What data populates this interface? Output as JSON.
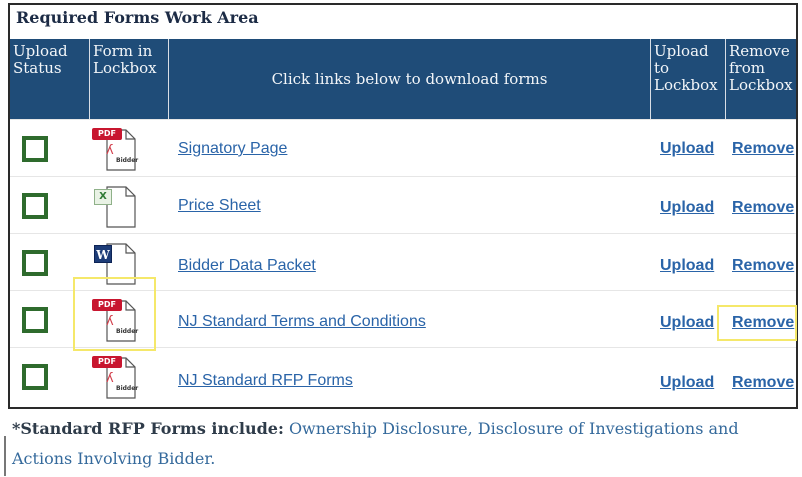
{
  "panel": {
    "title": "Required Forms Work Area"
  },
  "columns": {
    "upload_status": "Upload Status",
    "form_in_lockbox": "Form in Lockbox",
    "download_instruction": "Click links below to download forms",
    "upload_to_lockbox": "Upload to Lockbox",
    "remove_from_lockbox": "Remove from Lockbox"
  },
  "rows": [
    {
      "icon": "pdf-file-icon",
      "form": "Signatory Page",
      "upload": "Upload",
      "remove": "Remove"
    },
    {
      "icon": "excel-file-icon",
      "form": "Price Sheet",
      "upload": "Upload",
      "remove": "Remove"
    },
    {
      "icon": "word-file-icon",
      "form": "Bidder Data Packet",
      "upload": "Upload",
      "remove": "Remove"
    },
    {
      "icon": "pdf-file-icon",
      "form": "NJ Standard Terms and Conditions",
      "upload": "Upload",
      "remove": "Remove"
    },
    {
      "icon": "pdf-file-icon",
      "form": "NJ Standard RFP Forms",
      "upload": "Upload",
      "remove": "Remove"
    }
  ],
  "icon_labels": {
    "pdf": "PDF",
    "excel": "X",
    "word": "W",
    "stamp": "Bidder"
  },
  "footer": {
    "lead": "*Standard RFP Forms include:",
    "items": "Ownership Disclosure, Disclosure of Investigations and Actions Involving Bidder."
  },
  "colors": {
    "header_bg": "#1f4c78",
    "link": "#2a64a8",
    "status_box": "#2e6b2d",
    "highlight": "#f5e86a"
  }
}
